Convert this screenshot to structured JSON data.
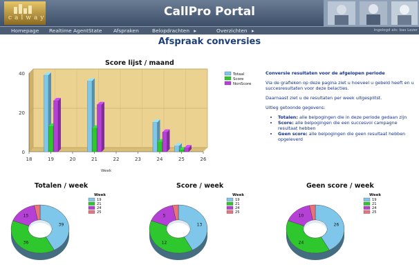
{
  "header": {
    "logo_text": "calway",
    "title": "CallPro Portal"
  },
  "nav": {
    "items": [
      {
        "label": "Homepage",
        "has_arrow": false
      },
      {
        "label": "Realtime AgentState",
        "has_arrow": false
      },
      {
        "label": "Afspraken",
        "has_arrow": false
      },
      {
        "label": "Belopdrachten",
        "has_arrow": true
      },
      {
        "label": "Overzichten",
        "has_arrow": true
      }
    ],
    "arrow": "▸",
    "login": "ingelogd als: bas Lezer"
  },
  "page_title": "Afspraak conversies",
  "description": {
    "heading": "Conversie resultaten voor de afgelopen periode",
    "p1": "Via de grafieken op deze pagina ziet u hoeveel u gebeld heeft en u succesresultaten voor deze belacties.",
    "p2": "Daarnaast ziet u de resultaten per week uitgesplitst.",
    "p3": "Uitleg getoonde gegevens:",
    "bullets": [
      {
        "term": "Totalen:",
        "text": " alle belpogingen die in deze periode gedaan zijn"
      },
      {
        "term": "Score:",
        "text": " alle belpogingen die een succesvol campagne resultaat hebben"
      },
      {
        "term": "Geen score:",
        "text": " alle belpogingen die geen resultaat hebben opgeleverd"
      }
    ]
  },
  "colors": {
    "totaal": "#7ec6ea",
    "score": "#2ec82e",
    "nonscore": "#b540d6",
    "w25": "#e8737b",
    "plot_bg": "#ecd291"
  },
  "chart_data": [
    {
      "type": "bar",
      "title": "Score lijst / maand",
      "xlabel": "Week",
      "ylabel": "",
      "x_ticks": [
        18,
        19,
        20,
        21,
        22,
        23,
        24,
        25,
        26
      ],
      "y_ticks": [
        0,
        20,
        40
      ],
      "ylim": [
        0,
        40
      ],
      "categories": [
        19,
        21,
        24,
        25
      ],
      "series": [
        {
          "name": "Totaal",
          "values": [
            39,
            36,
            15,
            3
          ]
        },
        {
          "name": "Score",
          "values": [
            13,
            12,
            5,
            1
          ]
        },
        {
          "name": "NonScore",
          "values": [
            26,
            24,
            10,
            2
          ]
        }
      ],
      "legend": "right"
    },
    {
      "type": "pie",
      "title": "Totalen / week",
      "legend_title": "Week",
      "labels": [
        "19",
        "21",
        "24",
        "25"
      ],
      "values": [
        39,
        36,
        15,
        3
      ],
      "legend": "top-right"
    },
    {
      "type": "pie",
      "title": "Score / week",
      "legend_title": "Week",
      "labels": [
        "19",
        "21",
        "24",
        "25"
      ],
      "values": [
        13,
        12,
        5,
        1
      ],
      "legend": "top-right"
    },
    {
      "type": "pie",
      "title": "Geen score / week",
      "legend_title": "Week",
      "labels": [
        "19",
        "21",
        "24",
        "25"
      ],
      "values": [
        26,
        24,
        10,
        2
      ],
      "legend": "top-right"
    }
  ]
}
